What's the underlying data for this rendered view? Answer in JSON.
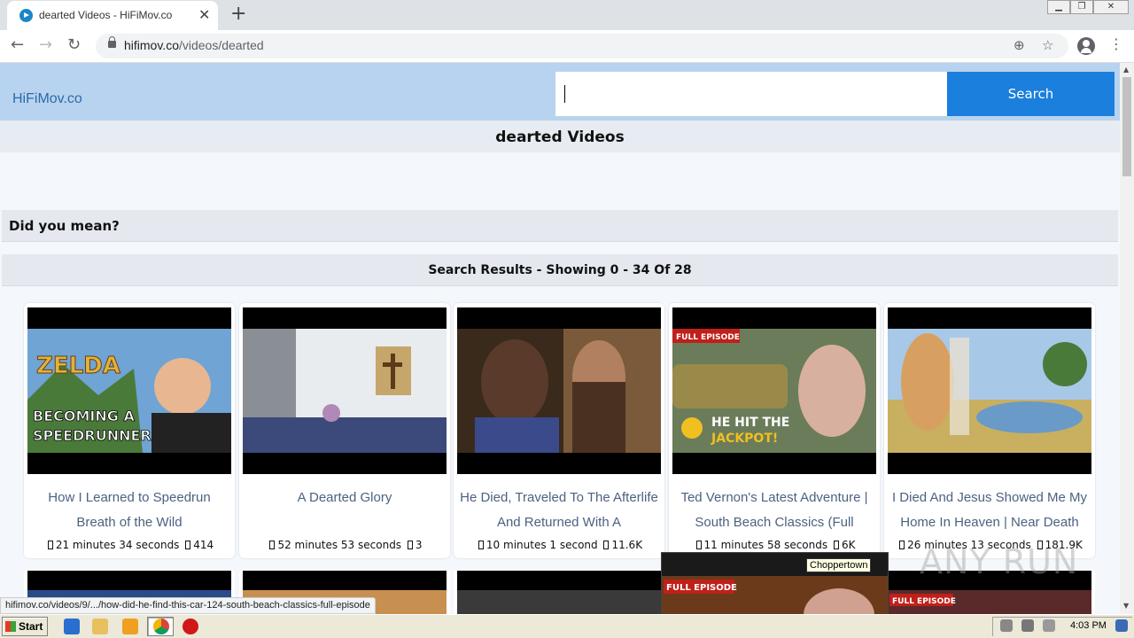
{
  "browser": {
    "tab_title": "dearted Videos - HiFiMov.co",
    "tab_close": "✕",
    "new_tab": "+",
    "url_host": "hifimov.co",
    "url_path": "/videos/dearted",
    "window_minimize": "▁",
    "window_restore": "❐",
    "window_close": "✕"
  },
  "site": {
    "logo": "HiFiMov.co",
    "search_value": "",
    "search_button": "Search",
    "page_title": "dearted Videos",
    "did_you_mean": "Did you mean?",
    "results_label": "Search Results - Showing 0 - 34 Of 28"
  },
  "videos": [
    {
      "title": "How I Learned to Speedrun Breath of the Wild",
      "duration": "21 minutes 34 seconds",
      "views": "414",
      "thumb_text": "BECOMING A SPEEDRUNNER",
      "thumb_logo": "ZELDA"
    },
    {
      "title": "A Dearted Glory",
      "duration": "52 minutes 53 seconds",
      "views": "3"
    },
    {
      "title": "He Died, Traveled To The Afterlife And Returned With A",
      "duration": "10 minutes 1 second",
      "views": "11.6K"
    },
    {
      "title": "Ted Vernon's Latest Adventure | South Beach Classics (Full",
      "duration": "11 minutes 58 seconds",
      "views": "6K",
      "thumb_badge": "FULL EPISODE",
      "thumb_text_1": "HE HIT THE",
      "thumb_text_2": "JACKPOT!"
    },
    {
      "title": "I Died And Jesus Showed Me My Home In Heaven | Near Death",
      "duration": "26 minutes 13 seconds",
      "views": "181.9K"
    }
  ],
  "row2_badges": [
    "FULL EPISODE",
    "FULL EPISODE"
  ],
  "tooltip": "Choppertown",
  "status_url": "hifimov.co/videos/9/.../how-did-he-find-this-car-124-south-beach-classics-full-episode",
  "watermark": "ANY RUN",
  "taskbar": {
    "start_label": "Start",
    "clock": "4:03 PM"
  }
}
